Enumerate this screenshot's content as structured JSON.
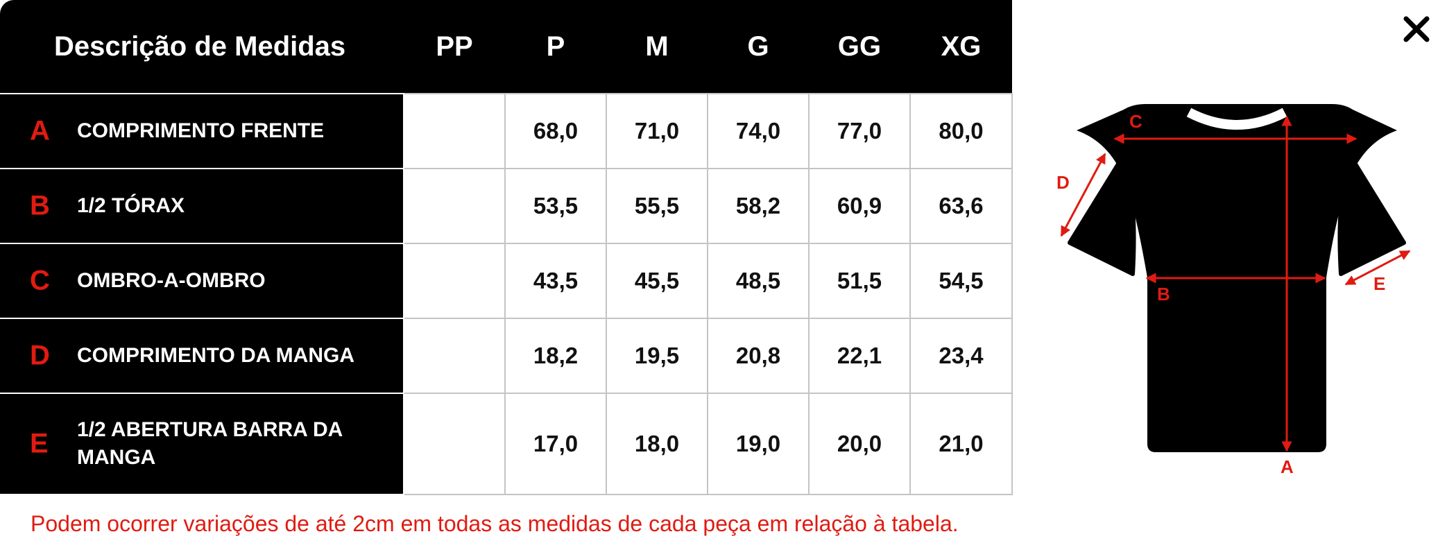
{
  "table": {
    "title": "Descrição de Medidas",
    "sizes": [
      "PP",
      "P",
      "M",
      "G",
      "GG",
      "XG"
    ],
    "rows": [
      {
        "letter": "A",
        "label": "COMPRIMENTO FRENTE",
        "values": [
          "",
          "68,0",
          "71,0",
          "74,0",
          "77,0",
          "80,0"
        ]
      },
      {
        "letter": "B",
        "label": "1/2 TÓRAX",
        "values": [
          "",
          "53,5",
          "55,5",
          "58,2",
          "60,9",
          "63,6"
        ]
      },
      {
        "letter": "C",
        "label": "OMBRO-A-OMBRO",
        "values": [
          "",
          "43,5",
          "45,5",
          "48,5",
          "51,5",
          "54,5"
        ]
      },
      {
        "letter": "D",
        "label": "COMPRIMENTO DA MANGA",
        "values": [
          "",
          "18,2",
          "19,5",
          "20,8",
          "22,1",
          "23,4"
        ]
      },
      {
        "letter": "E",
        "label": "1/2 ABERTURA BARRA DA MANGA",
        "values": [
          "",
          "17,0",
          "18,0",
          "19,0",
          "20,0",
          "21,0"
        ]
      }
    ]
  },
  "footnote": "Podem ocorrer variações de até 2cm em todas as medidas de cada peça em relação à tabela.",
  "diagram": {
    "labels": {
      "a": "A",
      "b": "B",
      "c": "C",
      "d": "D",
      "e": "E"
    }
  },
  "icons": {
    "close": "close-icon",
    "shirt": "tshirt-icon"
  },
  "colors": {
    "accent": "#e01b12",
    "header_bg": "#000000",
    "grid": "#c4c4c4"
  }
}
